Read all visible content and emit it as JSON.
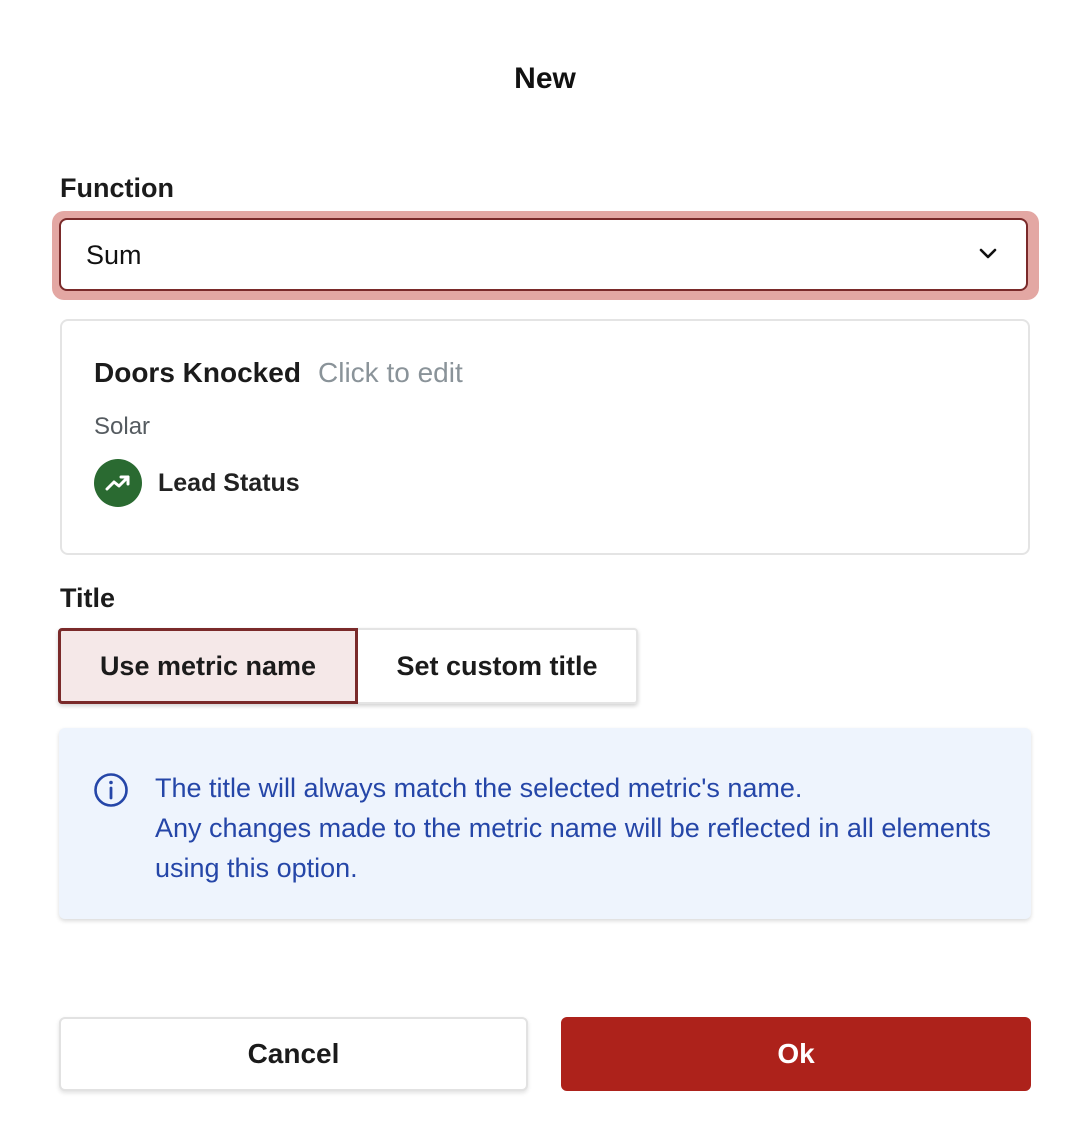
{
  "dialog": {
    "title": "New"
  },
  "function_field": {
    "label": "Function",
    "selected_value": "Sum"
  },
  "metric_card": {
    "name": "Doors Knocked",
    "edit_hint": "Click to edit",
    "category": "Solar",
    "source_label": "Lead Status",
    "source_icon": "trending-up-icon"
  },
  "title_field": {
    "label": "Title",
    "options": [
      {
        "label": "Use metric name",
        "selected": true
      },
      {
        "label": "Set custom title",
        "selected": false
      }
    ]
  },
  "info": {
    "icon": "info-icon",
    "line1": "The title will always match the selected metric's name.",
    "line2": "Any changes made to the metric name will be reflected in all elements using this option."
  },
  "footer": {
    "cancel_label": "Cancel",
    "ok_label": "Ok"
  },
  "colors": {
    "primary": "#ad221b",
    "selected_border": "#7a2a2a",
    "focus_ring": "#e3a7a3",
    "info_text": "#2546a8",
    "info_background": "#eef4fd",
    "source_icon_background": "#2a6a31"
  }
}
